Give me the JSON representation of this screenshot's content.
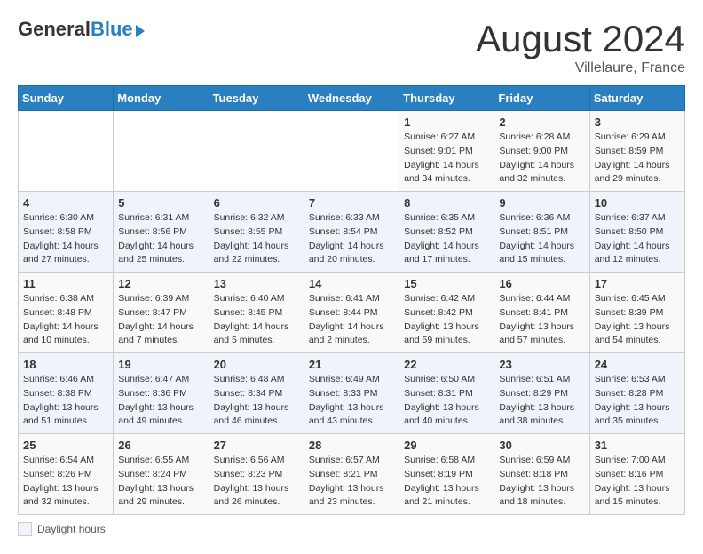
{
  "header": {
    "logo": {
      "general": "General",
      "blue": "Blue"
    },
    "title": "August 2024",
    "subtitle": "Villelaure, France"
  },
  "weekdays": [
    "Sunday",
    "Monday",
    "Tuesday",
    "Wednesday",
    "Thursday",
    "Friday",
    "Saturday"
  ],
  "weeks": [
    [
      {
        "day": "",
        "details": ""
      },
      {
        "day": "",
        "details": ""
      },
      {
        "day": "",
        "details": ""
      },
      {
        "day": "",
        "details": ""
      },
      {
        "day": "1",
        "details": "Sunrise: 6:27 AM\nSunset: 9:01 PM\nDaylight: 14 hours\nand 34 minutes."
      },
      {
        "day": "2",
        "details": "Sunrise: 6:28 AM\nSunset: 9:00 PM\nDaylight: 14 hours\nand 32 minutes."
      },
      {
        "day": "3",
        "details": "Sunrise: 6:29 AM\nSunset: 8:59 PM\nDaylight: 14 hours\nand 29 minutes."
      }
    ],
    [
      {
        "day": "4",
        "details": "Sunrise: 6:30 AM\nSunset: 8:58 PM\nDaylight: 14 hours\nand 27 minutes."
      },
      {
        "day": "5",
        "details": "Sunrise: 6:31 AM\nSunset: 8:56 PM\nDaylight: 14 hours\nand 25 minutes."
      },
      {
        "day": "6",
        "details": "Sunrise: 6:32 AM\nSunset: 8:55 PM\nDaylight: 14 hours\nand 22 minutes."
      },
      {
        "day": "7",
        "details": "Sunrise: 6:33 AM\nSunset: 8:54 PM\nDaylight: 14 hours\nand 20 minutes."
      },
      {
        "day": "8",
        "details": "Sunrise: 6:35 AM\nSunset: 8:52 PM\nDaylight: 14 hours\nand 17 minutes."
      },
      {
        "day": "9",
        "details": "Sunrise: 6:36 AM\nSunset: 8:51 PM\nDaylight: 14 hours\nand 15 minutes."
      },
      {
        "day": "10",
        "details": "Sunrise: 6:37 AM\nSunset: 8:50 PM\nDaylight: 14 hours\nand 12 minutes."
      }
    ],
    [
      {
        "day": "11",
        "details": "Sunrise: 6:38 AM\nSunset: 8:48 PM\nDaylight: 14 hours\nand 10 minutes."
      },
      {
        "day": "12",
        "details": "Sunrise: 6:39 AM\nSunset: 8:47 PM\nDaylight: 14 hours\nand 7 minutes."
      },
      {
        "day": "13",
        "details": "Sunrise: 6:40 AM\nSunset: 8:45 PM\nDaylight: 14 hours\nand 5 minutes."
      },
      {
        "day": "14",
        "details": "Sunrise: 6:41 AM\nSunset: 8:44 PM\nDaylight: 14 hours\nand 2 minutes."
      },
      {
        "day": "15",
        "details": "Sunrise: 6:42 AM\nSunset: 8:42 PM\nDaylight: 13 hours\nand 59 minutes."
      },
      {
        "day": "16",
        "details": "Sunrise: 6:44 AM\nSunset: 8:41 PM\nDaylight: 13 hours\nand 57 minutes."
      },
      {
        "day": "17",
        "details": "Sunrise: 6:45 AM\nSunset: 8:39 PM\nDaylight: 13 hours\nand 54 minutes."
      }
    ],
    [
      {
        "day": "18",
        "details": "Sunrise: 6:46 AM\nSunset: 8:38 PM\nDaylight: 13 hours\nand 51 minutes."
      },
      {
        "day": "19",
        "details": "Sunrise: 6:47 AM\nSunset: 8:36 PM\nDaylight: 13 hours\nand 49 minutes."
      },
      {
        "day": "20",
        "details": "Sunrise: 6:48 AM\nSunset: 8:34 PM\nDaylight: 13 hours\nand 46 minutes."
      },
      {
        "day": "21",
        "details": "Sunrise: 6:49 AM\nSunset: 8:33 PM\nDaylight: 13 hours\nand 43 minutes."
      },
      {
        "day": "22",
        "details": "Sunrise: 6:50 AM\nSunset: 8:31 PM\nDaylight: 13 hours\nand 40 minutes."
      },
      {
        "day": "23",
        "details": "Sunrise: 6:51 AM\nSunset: 8:29 PM\nDaylight: 13 hours\nand 38 minutes."
      },
      {
        "day": "24",
        "details": "Sunrise: 6:53 AM\nSunset: 8:28 PM\nDaylight: 13 hours\nand 35 minutes."
      }
    ],
    [
      {
        "day": "25",
        "details": "Sunrise: 6:54 AM\nSunset: 8:26 PM\nDaylight: 13 hours\nand 32 minutes."
      },
      {
        "day": "26",
        "details": "Sunrise: 6:55 AM\nSunset: 8:24 PM\nDaylight: 13 hours\nand 29 minutes."
      },
      {
        "day": "27",
        "details": "Sunrise: 6:56 AM\nSunset: 8:23 PM\nDaylight: 13 hours\nand 26 minutes."
      },
      {
        "day": "28",
        "details": "Sunrise: 6:57 AM\nSunset: 8:21 PM\nDaylight: 13 hours\nand 23 minutes."
      },
      {
        "day": "29",
        "details": "Sunrise: 6:58 AM\nSunset: 8:19 PM\nDaylight: 13 hours\nand 21 minutes."
      },
      {
        "day": "30",
        "details": "Sunrise: 6:59 AM\nSunset: 8:18 PM\nDaylight: 13 hours\nand 18 minutes."
      },
      {
        "day": "31",
        "details": "Sunrise: 7:00 AM\nSunset: 8:16 PM\nDaylight: 13 hours\nand 15 minutes."
      }
    ]
  ],
  "footer": {
    "label": "Daylight hours"
  }
}
